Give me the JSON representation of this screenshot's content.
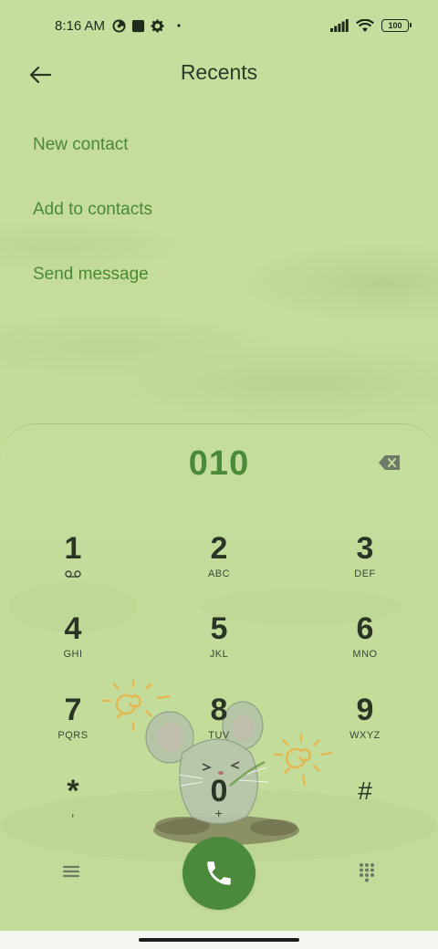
{
  "status_bar": {
    "time": "8:16 AM",
    "battery": "100",
    "icons": [
      "data-saver-icon",
      "square-notification-icon",
      "settings-gear-icon",
      "dot-icon",
      "signal-icon",
      "wifi-icon",
      "battery-icon"
    ]
  },
  "header": {
    "title": "Recents",
    "back_icon": "back-arrow-icon"
  },
  "actions": [
    {
      "label": "New contact"
    },
    {
      "label": "Add to contacts"
    },
    {
      "label": "Send message"
    }
  ],
  "dialpad": {
    "number": "010",
    "keys": [
      {
        "digit": "1",
        "letters": ""
      },
      {
        "digit": "2",
        "letters": "ABC"
      },
      {
        "digit": "3",
        "letters": "DEF"
      },
      {
        "digit": "4",
        "letters": "GHI"
      },
      {
        "digit": "5",
        "letters": "JKL"
      },
      {
        "digit": "6",
        "letters": "MNO"
      },
      {
        "digit": "7",
        "letters": "PQRS"
      },
      {
        "digit": "8",
        "letters": "TUV"
      },
      {
        "digit": "9",
        "letters": "WXYZ"
      },
      {
        "digit": "*",
        "letters": ","
      },
      {
        "digit": "0",
        "letters": "+"
      },
      {
        "digit": "#",
        "letters": ""
      }
    ]
  },
  "colors": {
    "background": "#c4dc9a",
    "accent": "#4a8a3a",
    "text": "#2a3526"
  }
}
